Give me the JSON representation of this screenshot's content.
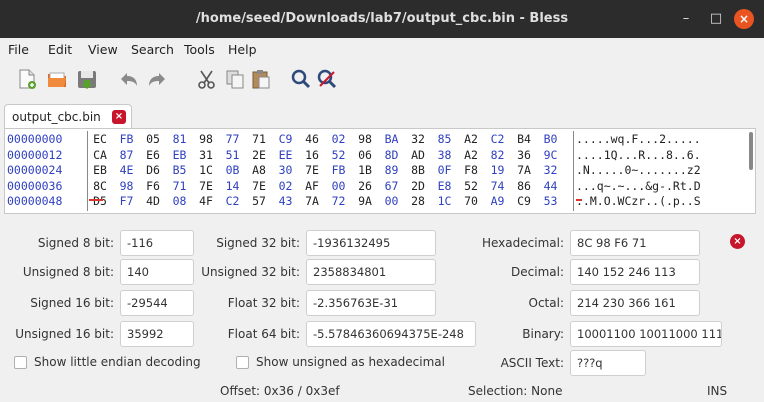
{
  "window": {
    "title": "/home/seed/Downloads/lab7/output_cbc.bin - Bless",
    "min_glyph": "–",
    "max_glyph": "□",
    "close_glyph": "×"
  },
  "menu": [
    "File",
    "Edit",
    "View",
    "Search",
    "Tools",
    "Help"
  ],
  "toolbar": {
    "icons": [
      "new-file-icon",
      "open-folder-icon",
      "save-icon",
      "undo-icon",
      "redo-icon",
      "cut-icon",
      "copy-icon",
      "paste-icon",
      "find-icon",
      "find-replace-icon"
    ]
  },
  "tab": {
    "label": "output_cbc.bin",
    "close_glyph": "×"
  },
  "hex": {
    "rows": [
      {
        "offset": "00000000",
        "bytes": [
          "EC",
          "FB",
          "05",
          "81",
          "98",
          "77",
          "71",
          "C9",
          "46",
          "02",
          "98",
          "BA",
          "32",
          "85",
          "A2",
          "C2",
          "B4",
          "B0"
        ],
        "ascii": ".....wq.F...2....."
      },
      {
        "offset": "00000012",
        "bytes": [
          "CA",
          "87",
          "E6",
          "EB",
          "31",
          "51",
          "2E",
          "EE",
          "16",
          "52",
          "06",
          "8D",
          "AD",
          "38",
          "A2",
          "82",
          "36",
          "9C"
        ],
        "ascii": "....1Q...R...8..6."
      },
      {
        "offset": "00000024",
        "bytes": [
          "EB",
          "4E",
          "D6",
          "B5",
          "1C",
          "0B",
          "A8",
          "30",
          "7E",
          "FB",
          "1B",
          "89",
          "8B",
          "0F",
          "F8",
          "19",
          "7A",
          "32"
        ],
        "ascii": ".N.....0~.......z2"
      },
      {
        "offset": "00000036",
        "bytes": [
          "8C",
          "98",
          "F6",
          "71",
          "7E",
          "14",
          "7E",
          "02",
          "AF",
          "00",
          "26",
          "67",
          "2D",
          "E8",
          "52",
          "74",
          "86",
          "44"
        ],
        "ascii": "...q~.~...&g-.Rt.D"
      },
      {
        "offset": "00000048",
        "bytes": [
          "D5",
          "F7",
          "4D",
          "08",
          "4F",
          "C2",
          "57",
          "43",
          "7A",
          "72",
          "9A",
          "00",
          "28",
          "1C",
          "70",
          "A9",
          "C9",
          "53"
        ],
        "ascii": "..M.O.WCzr..(.p..S"
      }
    ]
  },
  "converter": {
    "signed8_label": "Signed 8 bit:",
    "signed8": "-116",
    "unsigned8_label": "Unsigned 8 bit:",
    "unsigned8": "140",
    "signed16_label": "Signed 16 bit:",
    "signed16": "-29544",
    "unsigned16_label": "Unsigned 16 bit:",
    "unsigned16": "35992",
    "signed32_label": "Signed 32 bit:",
    "signed32": "-1936132495",
    "unsigned32_label": "Unsigned 32 bit:",
    "unsigned32": "2358834801",
    "float32_label": "Float 32 bit:",
    "float32": "-2.356763E-31",
    "float64_label": "Float 64 bit:",
    "float64": "-5.57846360694375E-248",
    "hex_label": "Hexadecimal:",
    "hex": "8C 98 F6 71",
    "dec_label": "Decimal:",
    "dec": "140 152 246 113",
    "oct_label": "Octal:",
    "oct": "214 230 366 161",
    "bin_label": "Binary:",
    "bin": "10001100 10011000 111",
    "ascii_label": "ASCII Text:",
    "ascii": "???q",
    "little_endian_label": "Show little endian decoding",
    "unsigned_hex_label": "Show unsigned as hexadecimal",
    "close_glyph": "×"
  },
  "status": {
    "offset": "Offset: 0x36 / 0x3ef",
    "selection": "Selection: None",
    "mode": "INS"
  },
  "colors": {
    "accent": "#e95420",
    "hex_blue": "#2e3fbf",
    "close_red": "#c7162b"
  }
}
